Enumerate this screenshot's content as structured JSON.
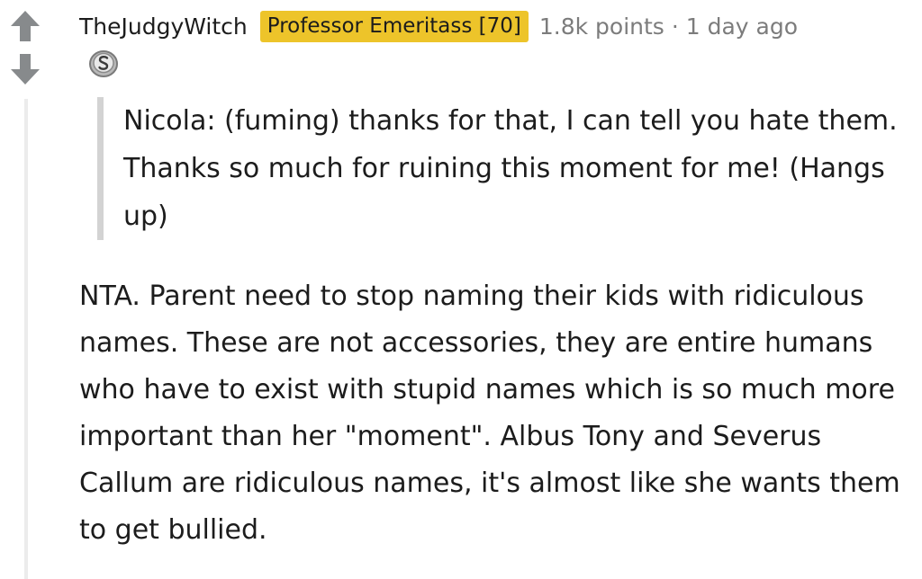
{
  "icons": {
    "upvote": "arrow-up-icon",
    "downvote": "arrow-down-icon",
    "award": "silver-award-icon"
  },
  "colors": {
    "flair_bg": "#edc42a",
    "meta_gray": "#7c7c7c",
    "text": "#1c1c1c",
    "quote_bar": "#d3d3d3",
    "thread_line": "#ececec",
    "arrow_gray": "#878a8c"
  },
  "comment": {
    "username": "TheJudgyWitch",
    "flair": "Professor Emeritass [70]",
    "points": "1.8k points",
    "separator": "·",
    "age": "1 day ago",
    "quote": "Nicola: (fuming) thanks for that, I can tell you hate them. Thanks so much for ruining this moment for me! (Hangs up)",
    "body": "NTA. Parent need to stop naming their kids with ridiculous names. These are not accessories, they are entire humans who have to exist with stupid names which is so much more important than her \"moment\". Albus Tony and Severus Callum are ridiculous names, it's almost like she wants them to get bullied."
  }
}
